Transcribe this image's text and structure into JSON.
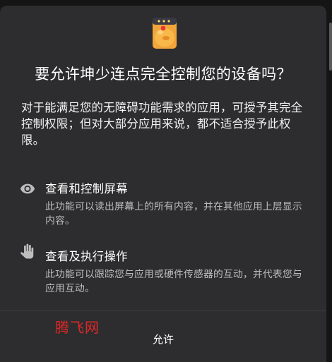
{
  "dialog": {
    "title": "要允许坤少连点完全控制您的设备吗？",
    "description": "对于能满足您的无障碍功能需求的应用，可授予其完全控制权限；但对大部分应用来说，都不适合授予此权限。",
    "app_icon": "app-avatar-icon"
  },
  "permissions": [
    {
      "icon": "eye-icon",
      "title": "查看和控制屏幕",
      "description": "此功能可以读出屏幕上的所有内容，并在其他应用上层显示内容。"
    },
    {
      "icon": "hand-icon",
      "title": "查看及执行操作",
      "description": "此功能可以跟踪您与应用或硬件传感器的互动，并代表您与应用互动。"
    }
  ],
  "watermark": "腾飞网",
  "buttons": {
    "allow": "允许"
  },
  "colors": {
    "dialog_background": "#2d2d2f",
    "secondary_text": "#bdbdbd",
    "watermark": "#e12828"
  }
}
